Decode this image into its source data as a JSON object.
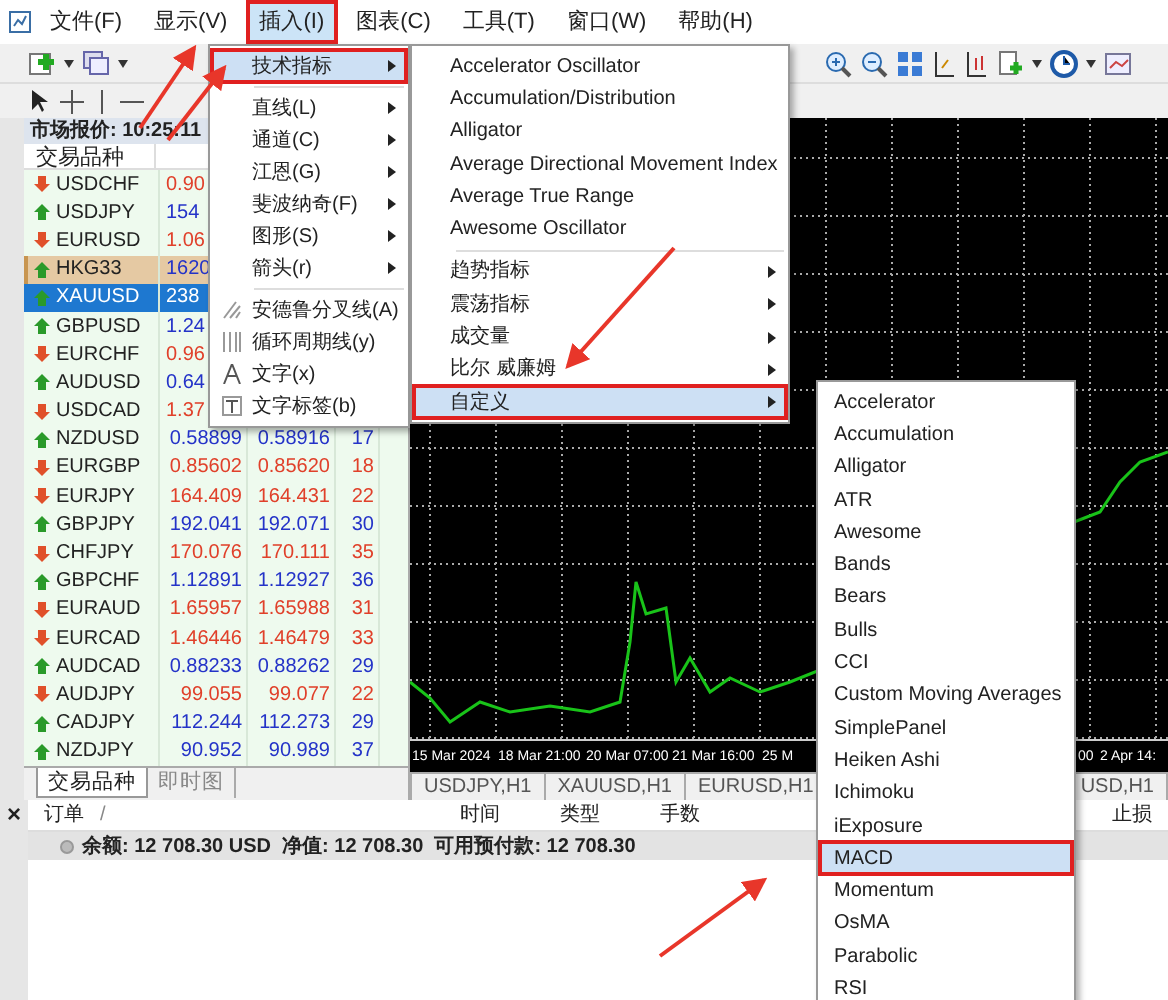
{
  "menu_bar": {
    "items": [
      {
        "label": "文件(F)",
        "selected": false,
        "outlined": false
      },
      {
        "label": "显示(V)",
        "selected": false,
        "outlined": false
      },
      {
        "label": "插入(I)",
        "selected": true,
        "outlined": true
      },
      {
        "label": "图表(C)",
        "selected": false,
        "outlined": false
      },
      {
        "label": "工具(T)",
        "selected": false,
        "outlined": false
      },
      {
        "label": "窗口(W)",
        "selected": false,
        "outlined": false
      },
      {
        "label": "帮助(H)",
        "selected": false,
        "outlined": false
      }
    ]
  },
  "market_watch": {
    "title": "市场报价: 10:25:11",
    "columns": [
      "交易品种"
    ],
    "rows": [
      {
        "symbol": "USDCHF",
        "bid": "0.90",
        "kind": "down",
        "selected": false,
        "highlighted": false
      },
      {
        "symbol": "USDJPY",
        "bid": "154",
        "kind": "up",
        "selected": false,
        "highlighted": false
      },
      {
        "symbol": "EURUSD",
        "bid": "1.06",
        "kind": "down",
        "selected": false,
        "highlighted": false
      },
      {
        "symbol": "HKG33",
        "bid": "1620",
        "kind": "up",
        "selected": false,
        "highlighted": true
      },
      {
        "symbol": "XAUUSD",
        "bid": "238",
        "kind": "up",
        "selected": true,
        "highlighted": false
      },
      {
        "symbol": "GBPUSD",
        "bid": "1.24",
        "kind": "up",
        "selected": false,
        "highlighted": false
      },
      {
        "symbol": "EURCHF",
        "bid": "0.96",
        "kind": "down",
        "selected": false,
        "highlighted": false
      },
      {
        "symbol": "AUDUSD",
        "bid": "0.64",
        "kind": "up",
        "selected": false,
        "highlighted": false
      },
      {
        "symbol": "USDCAD",
        "bid": "1.37",
        "kind": "down",
        "selected": false,
        "highlighted": false
      },
      {
        "symbol": "NZDUSD",
        "bid": "0.58899",
        "ask": "0.58916",
        "spread": "17",
        "kind": "up",
        "selected": false,
        "highlighted": false
      },
      {
        "symbol": "EURGBP",
        "bid": "0.85602",
        "ask": "0.85620",
        "spread": "18",
        "kind": "down",
        "selected": false,
        "highlighted": false
      },
      {
        "symbol": "EURJPY",
        "bid": "164.409",
        "ask": "164.431",
        "spread": "22",
        "kind": "down",
        "selected": false,
        "highlighted": false
      },
      {
        "symbol": "GBPJPY",
        "bid": "192.041",
        "ask": "192.071",
        "spread": "30",
        "kind": "up",
        "selected": false,
        "highlighted": false
      },
      {
        "symbol": "CHFJPY",
        "bid": "170.076",
        "ask": "170.111",
        "spread": "35",
        "kind": "down",
        "selected": false,
        "highlighted": false
      },
      {
        "symbol": "GBPCHF",
        "bid": "1.12891",
        "ask": "1.12927",
        "spread": "36",
        "kind": "up",
        "selected": false,
        "highlighted": false
      },
      {
        "symbol": "EURAUD",
        "bid": "1.65957",
        "ask": "1.65988",
        "spread": "31",
        "kind": "down",
        "selected": false,
        "highlighted": false
      },
      {
        "symbol": "EURCAD",
        "bid": "1.46446",
        "ask": "1.46479",
        "spread": "33",
        "kind": "down",
        "selected": false,
        "highlighted": false
      },
      {
        "symbol": "AUDCAD",
        "bid": "0.88233",
        "ask": "0.88262",
        "spread": "29",
        "kind": "up",
        "selected": false,
        "highlighted": false
      },
      {
        "symbol": "AUDJPY",
        "bid": "99.055",
        "ask": "99.077",
        "spread": "22",
        "kind": "down",
        "selected": false,
        "highlighted": false
      },
      {
        "symbol": "CADJPY",
        "bid": "112.244",
        "ask": "112.273",
        "spread": "29",
        "kind": "up",
        "selected": false,
        "highlighted": false
      },
      {
        "symbol": "NZDJPY",
        "bid": "90.952",
        "ask": "90.989",
        "spread": "37",
        "kind": "up",
        "selected": false,
        "highlighted": false
      }
    ],
    "tabs": [
      {
        "label": "交易品种",
        "selected": true
      },
      {
        "label": "即时图",
        "selected": false
      }
    ]
  },
  "chart": {
    "time_labels": [
      "15 Mar 2024",
      "18 Mar 21:00",
      "20 Mar 07:00",
      "21 Mar 16:00",
      "25 M"
    ],
    "right_time_labels": [
      "00",
      "2 Apr 14:"
    ]
  },
  "chart_tabs": {
    "left": [
      "USDJPY,H1",
      "XAUUSD,H1",
      "EURUSD,H1"
    ],
    "right": [
      "USD,H1"
    ]
  },
  "terminal": {
    "close": "×",
    "columns": [
      "订单",
      "/",
      "时间",
      "类型",
      "手数",
      "止损"
    ],
    "balance": "余额: 12 708.30 USD  净值: 12 708.30  可用预付款: 12 708.30"
  },
  "insert_menu": {
    "items": [
      {
        "kind": "item",
        "label": "技术指标",
        "submenu": true,
        "selected": true,
        "outlined": true
      },
      {
        "kind": "separator"
      },
      {
        "kind": "item",
        "label": "直线(L)",
        "submenu": true,
        "selected": false,
        "outlined": false
      },
      {
        "kind": "item",
        "label": "通道(C)",
        "submenu": true,
        "selected": false,
        "outlined": false
      },
      {
        "kind": "item",
        "label": "江恩(G)",
        "submenu": true,
        "selected": false,
        "outlined": false
      },
      {
        "kind": "item",
        "label": "斐波纳奇(F)",
        "submenu": true,
        "selected": false,
        "outlined": false
      },
      {
        "kind": "item",
        "label": "图形(S)",
        "submenu": true,
        "selected": false,
        "outlined": false
      },
      {
        "kind": "item",
        "label": "箭头(r)",
        "submenu": true,
        "selected": false,
        "outlined": false
      },
      {
        "kind": "separator"
      },
      {
        "kind": "tool",
        "label": "安德鲁分叉线(A)",
        "submenu": false,
        "selected": false,
        "outlined": false
      },
      {
        "kind": "tool",
        "label": "循环周期线(y)",
        "submenu": false,
        "selected": false,
        "outlined": false
      },
      {
        "kind": "tool",
        "label": "文字(x)",
        "submenu": false,
        "selected": false,
        "outlined": false
      },
      {
        "kind": "tool",
        "label": "文字标签(b)",
        "submenu": false,
        "selected": false,
        "outlined": false
      }
    ]
  },
  "indicators_menu": {
    "items": [
      {
        "kind": "item",
        "label": "Accelerator Oscillator",
        "submenu": false,
        "selected": false,
        "outlined": false
      },
      {
        "kind": "item",
        "label": "Accumulation/Distribution",
        "submenu": false,
        "selected": false,
        "outlined": false
      },
      {
        "kind": "item",
        "label": "Alligator",
        "submenu": false,
        "selected": false,
        "outlined": false
      },
      {
        "kind": "item",
        "label": "Average Directional Movement Index",
        "submenu": false,
        "selected": false,
        "outlined": false
      },
      {
        "kind": "item",
        "label": "Average True Range",
        "submenu": false,
        "selected": false,
        "outlined": false
      },
      {
        "kind": "item",
        "label": "Awesome Oscillator",
        "submenu": false,
        "selected": false,
        "outlined": false
      },
      {
        "kind": "separator"
      },
      {
        "kind": "item",
        "label": "趋势指标",
        "submenu": true,
        "selected": false,
        "outlined": false
      },
      {
        "kind": "item",
        "label": "震荡指标",
        "submenu": true,
        "selected": false,
        "outlined": false
      },
      {
        "kind": "item",
        "label": "成交量",
        "submenu": true,
        "selected": false,
        "outlined": false
      },
      {
        "kind": "item",
        "label": "比尔 威廉姆",
        "submenu": true,
        "selected": false,
        "outlined": false
      },
      {
        "kind": "item",
        "label": "自定义",
        "submenu": true,
        "selected": true,
        "outlined": true
      }
    ]
  },
  "custom_menu": {
    "items": [
      {
        "kind": "item",
        "label": "Accelerator",
        "selected": false,
        "outlined": false
      },
      {
        "kind": "item",
        "label": "Accumulation",
        "selected": false,
        "outlined": false
      },
      {
        "kind": "item",
        "label": "Alligator",
        "selected": false,
        "outlined": false
      },
      {
        "kind": "item",
        "label": "ATR",
        "selected": false,
        "outlined": false
      },
      {
        "kind": "item",
        "label": "Awesome",
        "selected": false,
        "outlined": false
      },
      {
        "kind": "item",
        "label": "Bands",
        "selected": false,
        "outlined": false
      },
      {
        "kind": "item",
        "label": "Bears",
        "selected": false,
        "outlined": false
      },
      {
        "kind": "item",
        "label": "Bulls",
        "selected": false,
        "outlined": false
      },
      {
        "kind": "item",
        "label": "CCI",
        "selected": false,
        "outlined": false
      },
      {
        "kind": "item",
        "label": "Custom Moving Averages",
        "selected": false,
        "outlined": false
      },
      {
        "kind": "item",
        "label": "SimplePanel",
        "selected": false,
        "outlined": false
      },
      {
        "kind": "item",
        "label": "Heiken Ashi",
        "selected": false,
        "outlined": false
      },
      {
        "kind": "item",
        "label": "Ichimoku",
        "selected": false,
        "outlined": false
      },
      {
        "kind": "item",
        "label": "iExposure",
        "selected": false,
        "outlined": false
      },
      {
        "kind": "item",
        "label": "MACD",
        "selected": true,
        "outlined": true
      },
      {
        "kind": "item",
        "label": "Momentum",
        "selected": false,
        "outlined": false
      },
      {
        "kind": "item",
        "label": "OsMA",
        "selected": false,
        "outlined": false
      },
      {
        "kind": "item",
        "label": "Parabolic",
        "selected": false,
        "outlined": false
      },
      {
        "kind": "item",
        "label": "RSI",
        "selected": false,
        "outlined": false
      }
    ]
  }
}
